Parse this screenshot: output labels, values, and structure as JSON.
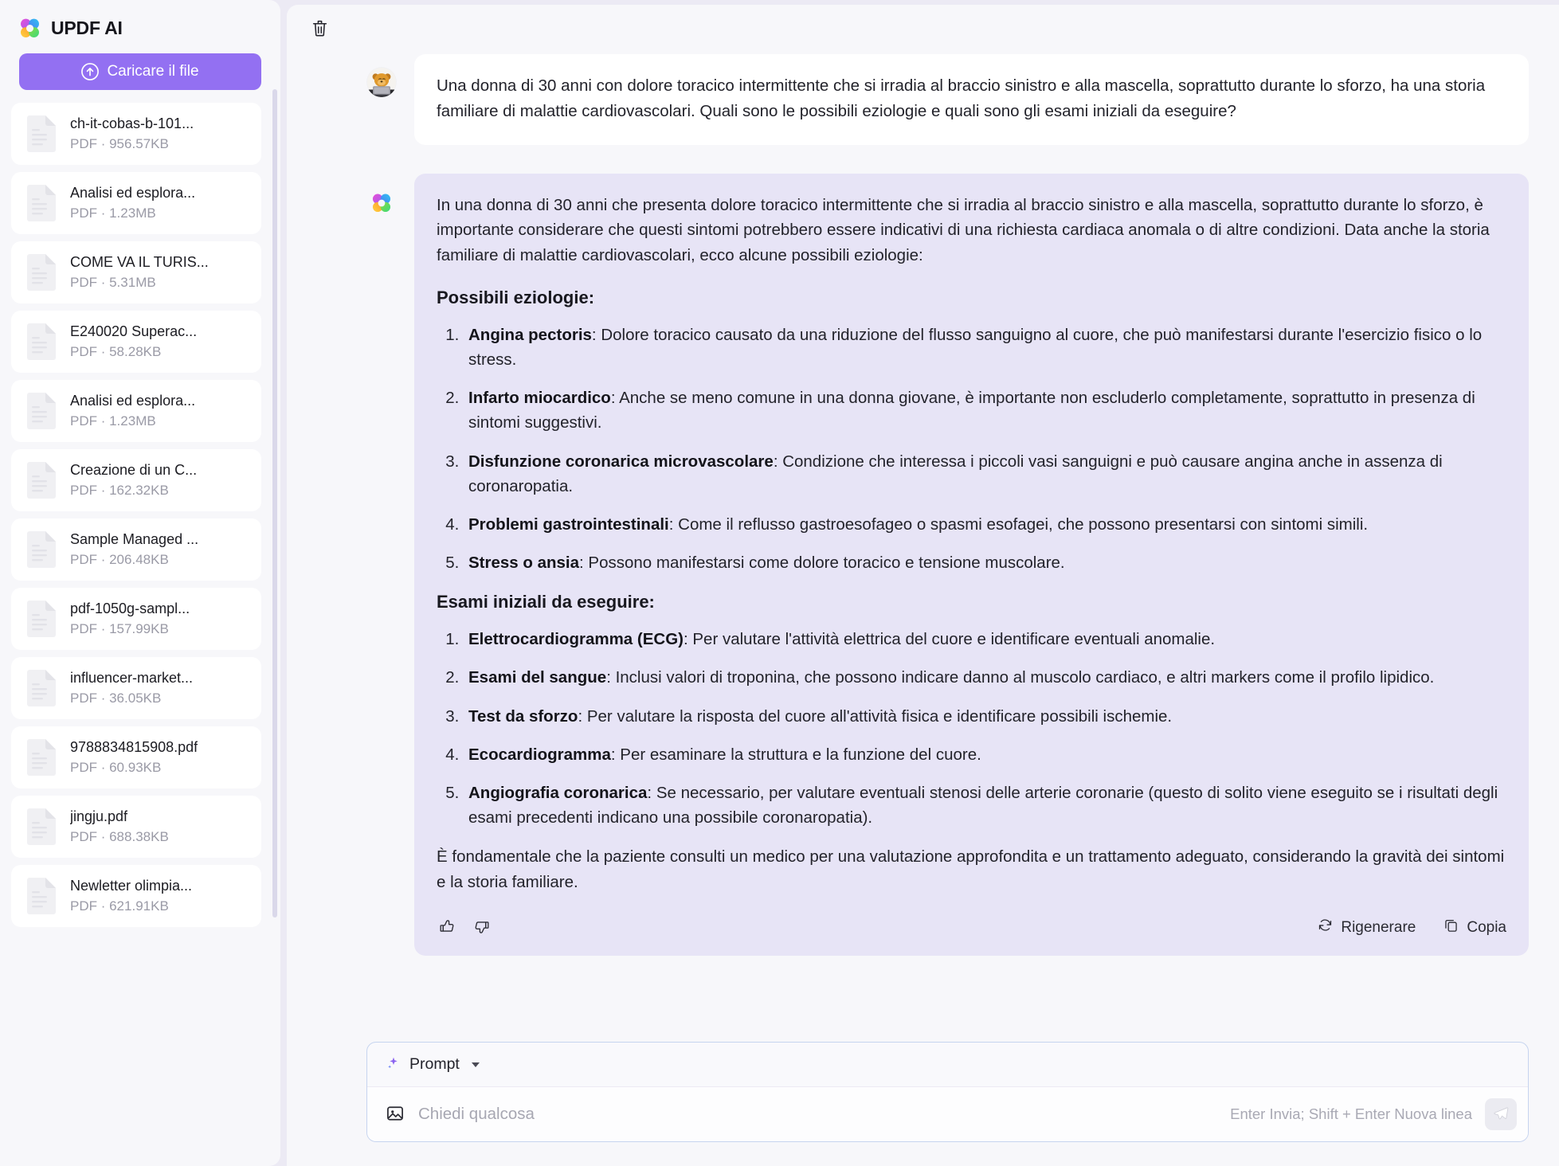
{
  "sidebar": {
    "brand": "UPDF AI",
    "brand_logo_icon": "updf-clover-logo",
    "upload_button": "Caricare il file",
    "upload_icon": "upload-arrow-icon",
    "files": [
      {
        "name": "ch-it-cobas-b-101...",
        "meta": "PDF · 956.57KB"
      },
      {
        "name": "Analisi ed esplora...",
        "meta": "PDF · 1.23MB"
      },
      {
        "name": "COME VA IL TURIS...",
        "meta": "PDF · 5.31MB"
      },
      {
        "name": "E240020 Superac...",
        "meta": "PDF · 58.28KB"
      },
      {
        "name": "Analisi ed esplora...",
        "meta": "PDF · 1.23MB"
      },
      {
        "name": "Creazione di un C...",
        "meta": "PDF · 162.32KB"
      },
      {
        "name": "Sample Managed ...",
        "meta": "PDF · 206.48KB"
      },
      {
        "name": "pdf-1050g-sampl...",
        "meta": "PDF · 157.99KB"
      },
      {
        "name": "influencer-market...",
        "meta": "PDF · 36.05KB"
      },
      {
        "name": "9788834815908.pdf",
        "meta": "PDF · 60.93KB"
      },
      {
        "name": "jingju.pdf",
        "meta": "PDF · 688.38KB"
      },
      {
        "name": "Newletter olimpia...",
        "meta": "PDF · 621.91KB"
      }
    ]
  },
  "toolbar": {
    "delete_icon": "trash-icon"
  },
  "chat": {
    "user_message": "Una donna di 30 anni con dolore toracico intermittente che si irradia al braccio sinistro e alla mascella, soprattutto durante lo sforzo, ha una storia familiare di malattie cardiovascolari. Quali sono le possibili eziologie e quali sono gli esami iniziali da eseguire?",
    "ai": {
      "intro": "In una donna di 30 anni che presenta dolore toracico intermittente che si irradia al braccio sinistro e alla mascella, soprattutto durante lo sforzo, è importante considerare che questi sintomi potrebbero essere indicativi di una richiesta cardiaca anomala o di altre condizioni. Data anche la storia familiare di malattie cardiovascolari, ecco alcune possibili eziologie:",
      "section1_title": "Possibili eziologie:",
      "section1_items": [
        {
          "term": "Angina pectoris",
          "text": ": Dolore toracico causato da una riduzione del flusso sanguigno al cuore, che può manifestarsi durante l'esercizio fisico o lo stress."
        },
        {
          "term": "Infarto miocardico",
          "text": ": Anche se meno comune in una donna giovane, è importante non escluderlo completamente, soprattutto in presenza di sintomi suggestivi."
        },
        {
          "term": "Disfunzione coronarica microvascolare",
          "text": ": Condizione che interessa i piccoli vasi sanguigni e può causare angina anche in assenza di coronaropatia."
        },
        {
          "term": "Problemi gastrointestinali",
          "text": ": Come il reflusso gastroesofageo o spasmi esofagei, che possono presentarsi con sintomi simili."
        },
        {
          "term": "Stress o ansia",
          "text": ": Possono manifestarsi come dolore toracico e tensione muscolare."
        }
      ],
      "section2_title": "Esami iniziali da eseguire:",
      "section2_items": [
        {
          "term": "Elettrocardiogramma (ECG)",
          "text": ": Per valutare l'attività elettrica del cuore e identificare eventuali anomalie."
        },
        {
          "term": "Esami del sangue",
          "text": ": Inclusi valori di troponina, che possono indicare danno al muscolo cardiaco, e altri markers come il profilo lipidico."
        },
        {
          "term": "Test da sforzo",
          "text": ": Per valutare la risposta del cuore all'attività fisica e identificare possibili ischemie."
        },
        {
          "term": "Ecocardiogramma",
          "text": ": Per esaminare la struttura e la funzione del cuore."
        },
        {
          "term": "Angiografia coronarica",
          "text": ": Se necessario, per valutare eventuali stenosi delle arterie coronarie (questo di solito viene eseguito se i risultati degli esami precedenti indicano una possibile coronaropatia)."
        }
      ],
      "outro": "È fondamentale che la paziente consulti un medico per una valutazione approfondita e un trattamento adeguato, considerando la gravità dei sintomi e la storia familiare.",
      "actions": {
        "thumbs_up_icon": "thumbs-up-icon",
        "thumbs_down_icon": "thumbs-down-icon",
        "regenerate_label": "Rigenerare",
        "regenerate_icon": "refresh-icon",
        "copy_label": "Copia",
        "copy_icon": "copy-icon"
      }
    }
  },
  "composer": {
    "prompt_label": "Prompt",
    "prompt_icon": "sparkle-icon",
    "image_icon": "image-icon",
    "input_value": "",
    "placeholder": "Chiedi qualcosa",
    "hint": "Enter Invia; Shift + Enter Nuova linea",
    "send_icon": "send-paperplane-icon"
  },
  "colors": {
    "accent": "#9370f2",
    "ai_bubble": "#e7e4f6",
    "sidebar_bg": "#f7f7fa",
    "page_bg": "#eceaf4"
  }
}
